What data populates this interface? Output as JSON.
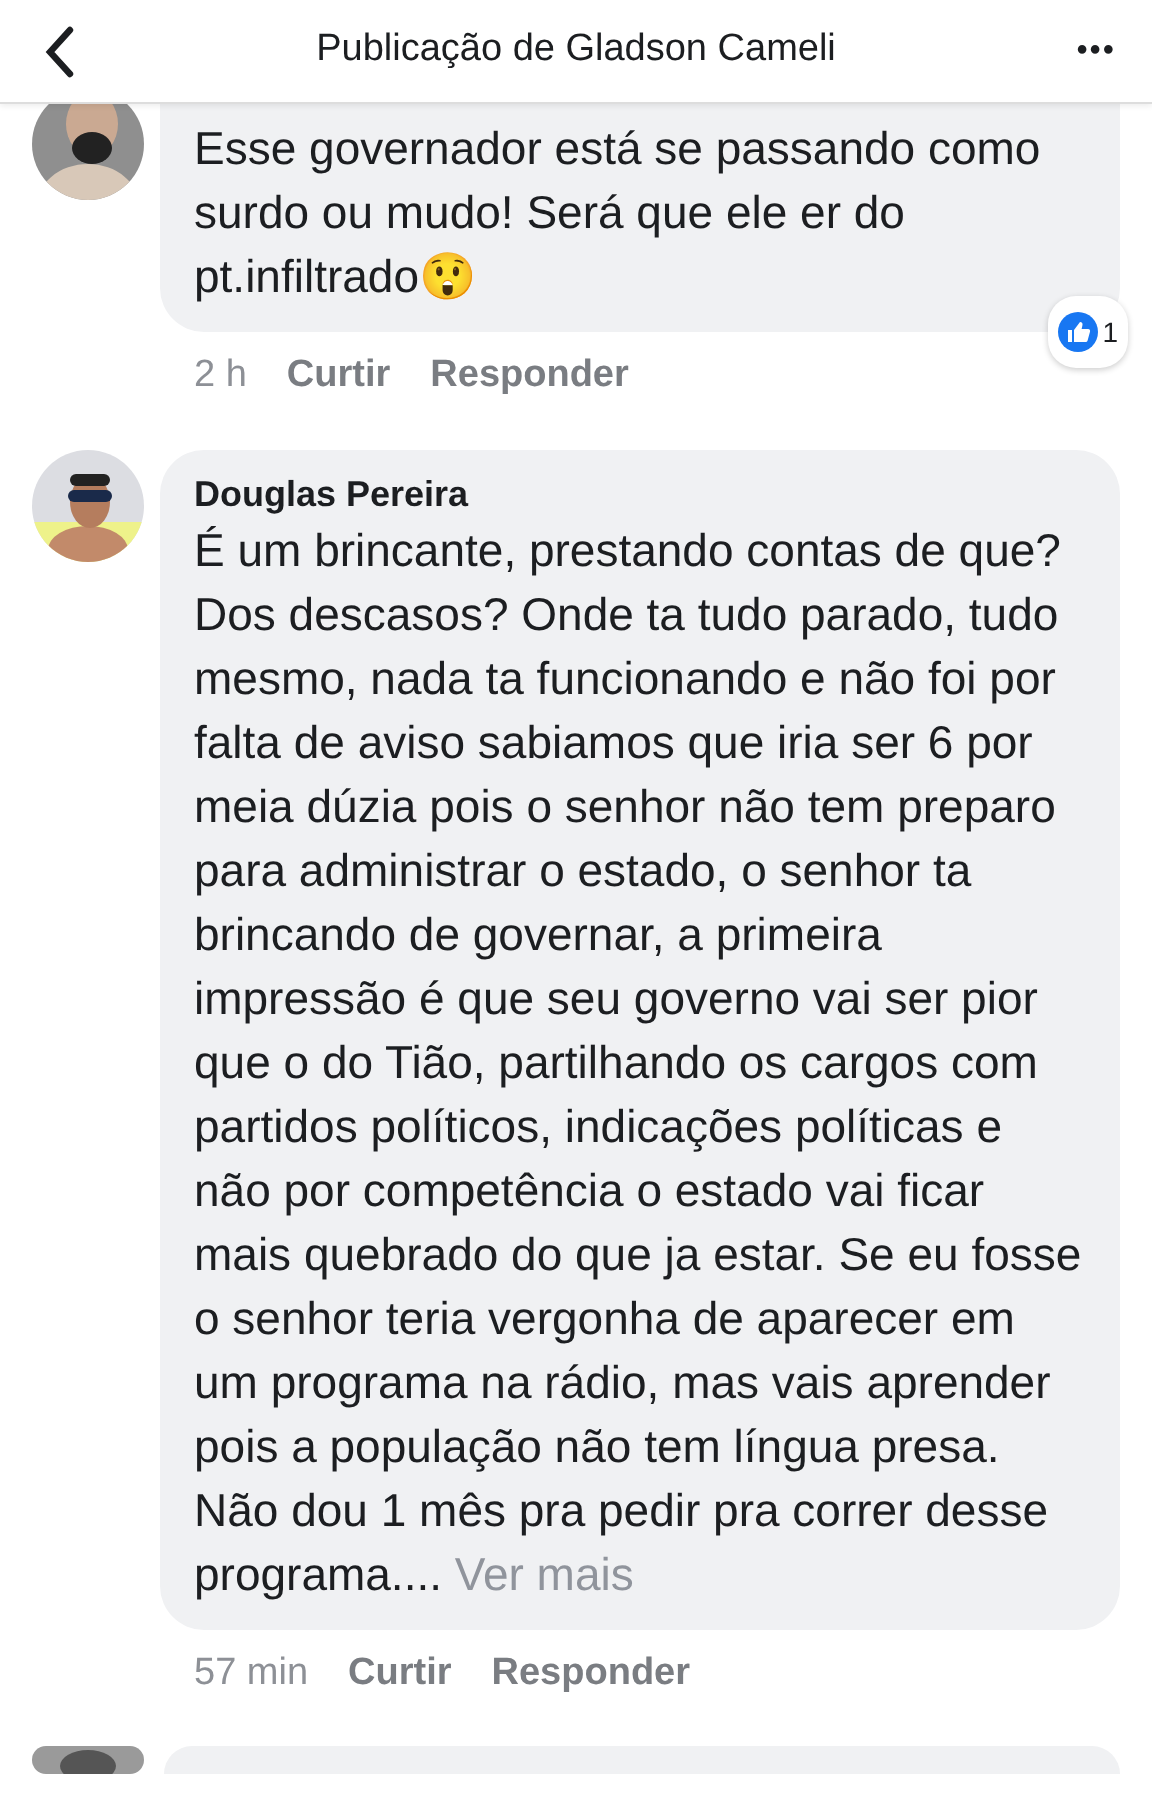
{
  "header": {
    "title": "Publicação de Gladson Cameli",
    "more": "•••"
  },
  "comments": [
    {
      "text": "Esse governador está se passando como surdo ou mudo! Será que ele er do pt.infiltrado😲",
      "time": "2 h",
      "like": "Curtir",
      "reply": "Responder",
      "reactions": "1"
    },
    {
      "author": "Douglas Pereira",
      "text": "É um brincante, prestando contas de que? Dos descasos? Onde ta tudo parado, tudo mesmo, nada ta funcionando e não foi por falta de aviso sabiamos que iria ser 6 por meia dúzia pois o senhor não tem preparo para administrar o estado, o senhor ta brincando de governar, a primeira impressão é que seu governo vai ser pior que o do Tião, partilhando os cargos com partidos políticos, indicações políticas e não por competência o estado vai ficar mais quebrado do que ja estar. Se eu fosse o senhor teria vergonha de aparecer em um programa na rádio, mas vais aprender pois a população não tem língua presa. Não dou 1 mês pra pedir pra correr desse programa....",
      "see_more": "Ver mais",
      "time": "57 min",
      "like": "Curtir",
      "reply": "Responder"
    }
  ]
}
